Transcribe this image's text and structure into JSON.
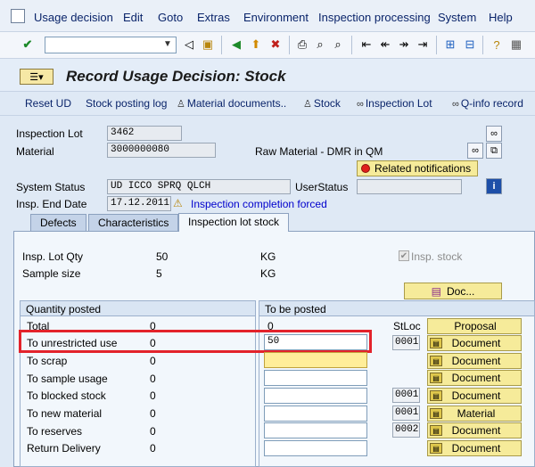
{
  "menu": {
    "items": [
      "Usage decision",
      "Edit",
      "Goto",
      "Extras",
      "Environment",
      "Inspection processing",
      "System",
      "Help"
    ]
  },
  "toolbar": {
    "command_value": "",
    "icons": [
      "enter-icon",
      "back-icon",
      "save-icon",
      "back-green-icon",
      "exit-icon",
      "cancel-icon",
      "print-icon",
      "find-icon",
      "find-next-icon",
      "first-page-icon",
      "prev-page-icon",
      "next-page-icon",
      "last-page-icon",
      "new-session-icon",
      "shortcut-icon",
      "help-icon",
      "layout-icon"
    ]
  },
  "title": {
    "text": "Record Usage Decision: Stock"
  },
  "app_toolbar": {
    "reset_ud": "Reset UD",
    "stock_posting_log": "Stock posting log",
    "material_documents": "Material documents..",
    "stock": "Stock",
    "inspection_lot": "Inspection Lot",
    "qinfo_record": "Q-info record"
  },
  "header": {
    "inspection_lot_label": "Inspection Lot",
    "inspection_lot_value": "3462",
    "material_label": "Material",
    "material_value": "3000000080",
    "material_desc": "Raw Material - DMR in QM",
    "related_notifications": "Related notifications",
    "system_status_label": "System Status",
    "system_status_value": "UD   ICCO SPRQ QLCH",
    "user_status_label": "UserStatus",
    "user_status_value": "",
    "insp_end_date_label": "Insp. End Date",
    "insp_end_date_value": "17.12.2011",
    "completion_text": "Inspection completion forced"
  },
  "tabs": [
    {
      "label": "Defects",
      "active": false
    },
    {
      "label": "Characteristics",
      "active": false
    },
    {
      "label": "Inspection lot stock",
      "active": true
    }
  ],
  "stock_tab": {
    "insp_lot_qty_label": "Insp. Lot Qty",
    "insp_lot_qty_value": "50",
    "insp_lot_qty_unit": "KG",
    "sample_size_label": "Sample size",
    "sample_size_value": "5",
    "sample_size_unit": "KG",
    "insp_stock_label": "Insp. stock",
    "doc_button": "Doc...",
    "quantity_posted_header": "Quantity posted",
    "to_be_posted_header": "To be posted",
    "to_be_posted_total": "0",
    "stloc_header": "StLoc",
    "rows": [
      {
        "label": "Total",
        "posted": "0",
        "input": null,
        "sloc": null,
        "button": "Proposal"
      },
      {
        "label": "To unrestricted use",
        "posted": "0",
        "input": "50",
        "sloc": "0001",
        "button": "Document"
      },
      {
        "label": "To scrap",
        "posted": "0",
        "input": "",
        "sloc": null,
        "button": "Document"
      },
      {
        "label": "To sample usage",
        "posted": "0",
        "input": "",
        "sloc": null,
        "button": "Document"
      },
      {
        "label": "To blocked stock",
        "posted": "0",
        "input": "",
        "sloc": "0001",
        "button": "Document"
      },
      {
        "label": "To new material",
        "posted": "0",
        "input": "",
        "sloc": "0001",
        "button": "Material"
      },
      {
        "label": "To reserves",
        "posted": "0",
        "input": "",
        "sloc": "0002",
        "button": "Document"
      },
      {
        "label": "Return Delivery",
        "posted": "0",
        "input": "",
        "sloc": null,
        "button": "Document"
      }
    ]
  },
  "colors": {
    "highlight_border": "#e3232b",
    "button_yellow": "#f6eb9a",
    "required_field": "#ffee99"
  }
}
